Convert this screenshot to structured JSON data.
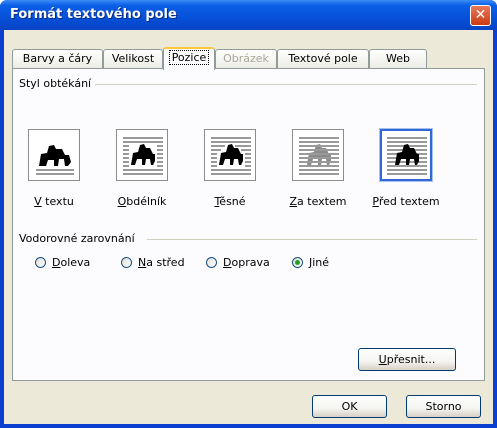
{
  "window": {
    "title": "Formát textového pole",
    "close_symbol": "✕"
  },
  "tabs": [
    {
      "label": "Barvy a čáry",
      "state": "normal"
    },
    {
      "label": "Velikost",
      "state": "normal"
    },
    {
      "label": "Pozice",
      "state": "active"
    },
    {
      "label": "Obrázek",
      "state": "disabled"
    },
    {
      "label": "Textové pole",
      "state": "normal"
    },
    {
      "label": "Web",
      "state": "normal"
    }
  ],
  "wrapping": {
    "group_label": "Styl obtékání",
    "options": [
      {
        "mnemonic": "V",
        "rest": " textu",
        "icon": "inline-with-text-icon",
        "selected": false
      },
      {
        "mnemonic": "O",
        "rest": "bdélník",
        "icon": "square-wrap-icon",
        "selected": false
      },
      {
        "mnemonic": "T",
        "rest": "ěsné",
        "icon": "tight-wrap-icon",
        "selected": false
      },
      {
        "mnemonic": "Z",
        "rest": "a textem",
        "icon": "behind-text-icon",
        "selected": false
      },
      {
        "mnemonic": "P",
        "rest": "řed textem",
        "icon": "in-front-of-text-icon",
        "selected": true
      }
    ]
  },
  "horizontal_alignment": {
    "group_label": "Vodorovné zarovnání",
    "options": [
      {
        "mnemonic": "D",
        "rest": "oleva",
        "checked": false
      },
      {
        "mnemonic": "N",
        "rest": "a střed",
        "checked": false
      },
      {
        "mnemonic": "D",
        "rest": "oprava",
        "checked": false
      },
      {
        "mnemonic": "J",
        "rest": "iné",
        "checked": true
      }
    ]
  },
  "buttons": {
    "advanced": {
      "mnemonic": "U",
      "rest": "přesnit..."
    },
    "ok": "OK",
    "cancel": "Storno"
  },
  "colors": {
    "titlebar": "#0650d8",
    "dialog_bg": "#ece9d8",
    "panel_bg": "#fcfcfe",
    "active_tab_accent": "#ffc83c",
    "selection_border": "#3168d5",
    "radio_check": "#21a121"
  }
}
